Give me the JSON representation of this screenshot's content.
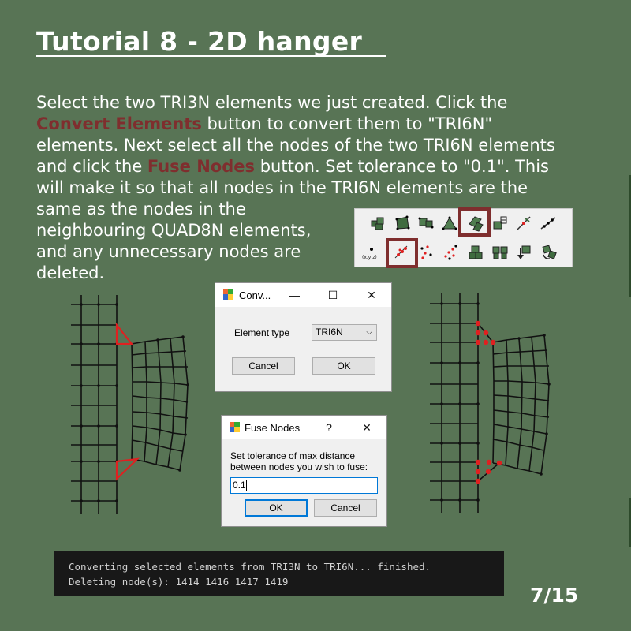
{
  "slide": {
    "title": "Tutorial 8 - 2D hanger ",
    "page_number": "7/15"
  },
  "instructions": {
    "line1": "Select the two TRI3N elements we just created. Click the",
    "line2_highlight": "Convert Elements",
    "line2_rest": " button to convert them to \"TRI6N\"",
    "line3": "elements. Next select all the nodes of the two TRI6N elements",
    "line4_pre": "and click the ",
    "line4_highlight": "Fuse Nodes",
    "line4_rest": " button. Set tolerance to \"0.1\". This",
    "line5": "will make it so that all nodes in the TRI6N elements are the",
    "line6": "same as the nodes in the",
    "line7": "neighbouring QUAD8N elements,",
    "line8": "and any unnecessary nodes are",
    "line9": "deleted.",
    "highlight_color": "#7f2e2e"
  },
  "toolbar": {
    "row1_icons": [
      "mesh-block-icon",
      "quad-element-icon",
      "element-node-icon",
      "triangle-element-icon",
      "convert-elements-icon",
      "element-export-icon",
      "line-node-icon",
      "line-multi-node-icon"
    ],
    "row2_icons": [
      "node-coord-icon",
      "fuse-nodes-icon",
      "node-scatter-icon",
      "node-remove-icon",
      "block-merge-icon",
      "block-split-icon",
      "move-down-icon",
      "rotate-block-icon"
    ],
    "highlighted": [
      "convert-elements-icon",
      "fuse-nodes-icon"
    ],
    "node_coord_label": "(x,y,z)"
  },
  "convert_dialog": {
    "title": "Conv...",
    "element_type_label": "Element type",
    "element_type_value": "TRI6N",
    "cancel_label": "Cancel",
    "ok_label": "OK",
    "minimize": "—",
    "maximize": "☐",
    "close": "✕"
  },
  "fuse_dialog": {
    "title": "Fuse Nodes",
    "help": "?",
    "close": "✕",
    "prompt_line1": "Set tolerance of max distance",
    "prompt_line2": "between nodes you wish to fuse:",
    "tolerance_value": "0.1",
    "ok_label": "OK",
    "cancel_label": "Cancel"
  },
  "console": {
    "line1": "Converting selected elements from TRI3N to TRI6N... finished.",
    "line2": "Deleting node(s): 1414 1416 1417 1419"
  },
  "colors": {
    "background": "#587455",
    "accent_red": "#e02020",
    "dialog_focus": "#0078d7"
  }
}
